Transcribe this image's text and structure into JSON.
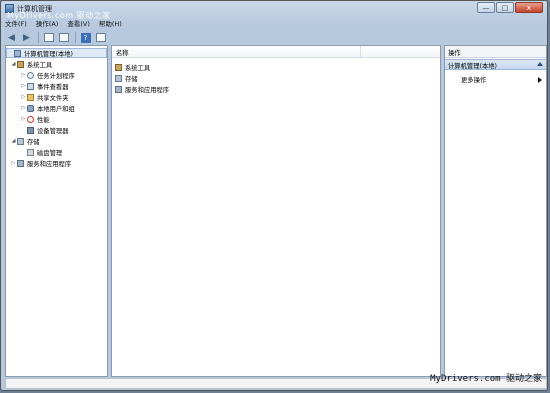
{
  "window": {
    "title": "计算机管理",
    "watermark_top": "MyDrivers.com 驱动之家",
    "controls": [
      "—",
      "□",
      "x"
    ]
  },
  "menu": [
    "文件(F)",
    "操作(A)",
    "查看(V)",
    "帮助(H)"
  ],
  "toolbar": {
    "icons": [
      "back-arrow-icon",
      "forward-arrow-icon",
      "show-hide-tree-icon",
      "export-icon",
      "help-icon",
      "properties-icon"
    ],
    "help_label": "?"
  },
  "tree": {
    "root": "计算机管理(本地)",
    "system_tools": "系统工具",
    "task_scheduler": "任务计划程序",
    "event_viewer": "事件查看器",
    "shared_folders": "共享文件夹",
    "local_users": "本地用户和组",
    "performance": "性能",
    "device_manager": "设备管理器",
    "storage": "存储",
    "disk_management": "磁盘管理",
    "services_apps": "服务和应用程序"
  },
  "center": {
    "column_name": "名称",
    "items": [
      "系统工具",
      "存储",
      "服务和应用程序"
    ]
  },
  "actions": {
    "title": "操作",
    "section": "计算机管理(本地)",
    "more": "更多操作"
  },
  "footer": {
    "watermark": "MyDrivers.com 驱动之家"
  },
  "colors": {
    "frame": "#b7c9df",
    "selection": "#dfe9f5",
    "panel_bg": "#ffffff"
  }
}
